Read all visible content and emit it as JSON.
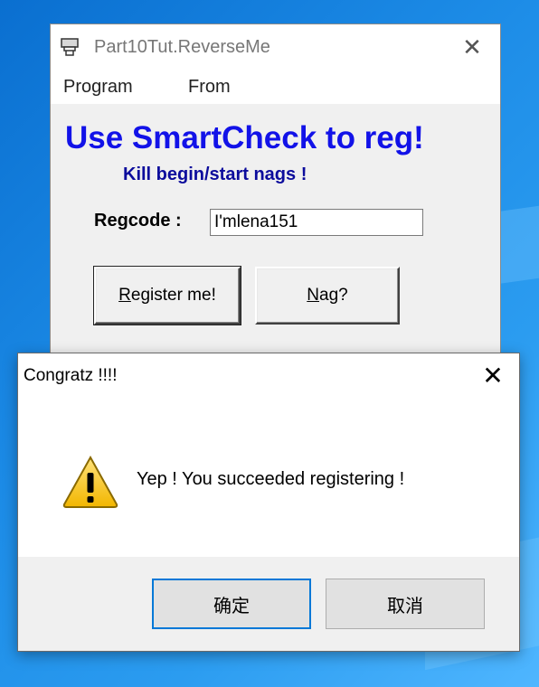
{
  "main_window": {
    "title": "Part10Tut.ReverseMe",
    "menu": [
      "Program",
      "From"
    ],
    "headline": "Use SmartCheck to reg!",
    "subline": "Kill begin/start nags !",
    "regcode_label": "Regcode :",
    "regcode_value": "I'mlena151",
    "buttons": {
      "register_mnemonic": "R",
      "register_rest": "egister me!",
      "nag_mnemonic": "N",
      "nag_rest": "ag?"
    },
    "colors": {
      "headline": "#1212e8",
      "subline": "#0c0c9c"
    }
  },
  "dialog": {
    "title": "Congratz !!!!",
    "message": "Yep ! You succeeded registering !",
    "icon": "warning-icon",
    "ok_label": "确定",
    "cancel_label": "取消"
  },
  "icons": {
    "close": "close-icon",
    "app": "app-icon"
  }
}
